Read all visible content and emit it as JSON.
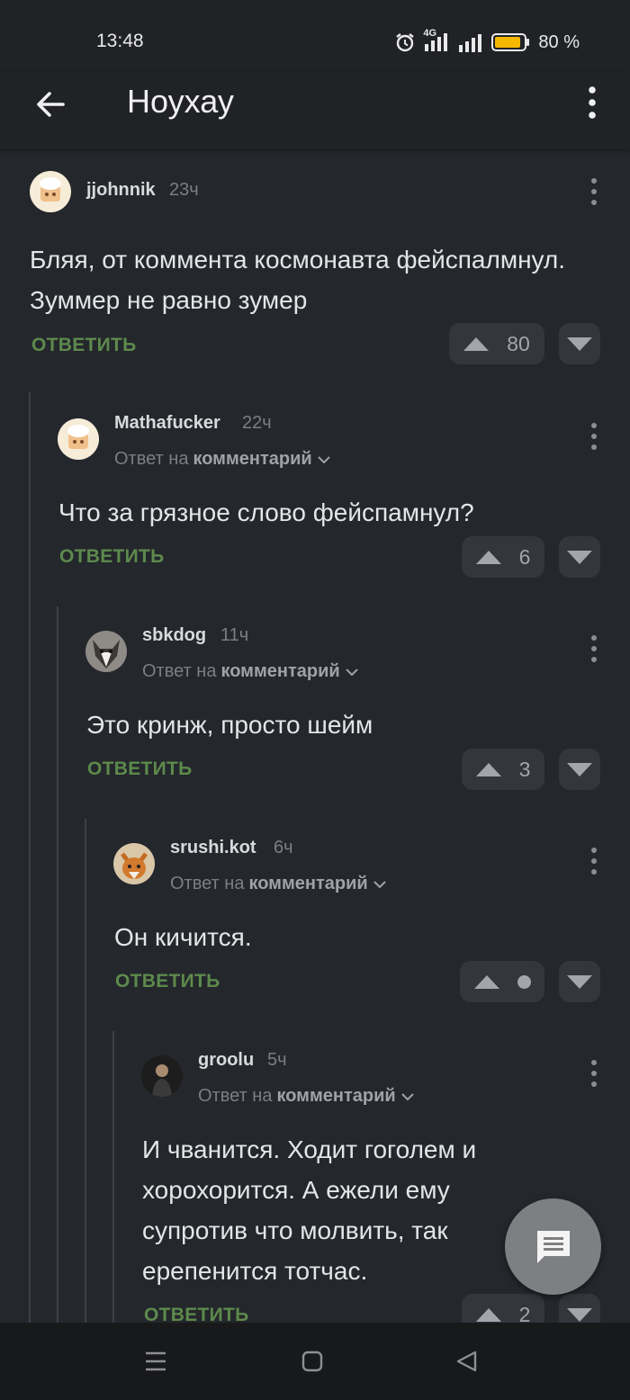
{
  "status": {
    "time": "13:48",
    "network": "4G",
    "battery": "80 %",
    "colors": {
      "battery": "#f4b800"
    }
  },
  "appbar": {
    "title": "Ноухау",
    "back_icon": "arrow-left-icon",
    "menu_icon": "more-vertical-icon"
  },
  "reply_label": "ОТВЕТИТЬ",
  "comments": [
    {
      "author": "jjohnnik",
      "time": "23ч",
      "text": "Бляя, от коммента космонавта фейспалмнул. Зуммер не равно зумер",
      "votes": "80"
    },
    {
      "author": "Mathafucker",
      "time": "22ч",
      "reply_prefix": "Ответ на",
      "reply_target": "комментарий",
      "text": "Что за грязное слово фейспамнул?",
      "votes": "6"
    },
    {
      "author": "sbkdog",
      "time": "11ч",
      "reply_prefix": "Ответ на",
      "reply_target": "комментарий",
      "text": "Это кринж, просто шейм",
      "votes": "3"
    },
    {
      "author": "srushi.kot",
      "time": "6ч",
      "reply_prefix": "Ответ на",
      "reply_target": "комментарий",
      "text": "Он кичится.",
      "votes": ""
    },
    {
      "author": "groolu",
      "time": "5ч",
      "reply_prefix": "Ответ на",
      "reply_target": "комментарий",
      "text": "И чванится. Ходит гоголем и хорохорится. А ежели ему супротив что молвить, так ерепенится тотчас.",
      "votes": "2"
    }
  ],
  "fab": {
    "icon": "comment-icon"
  },
  "navbar": {
    "icons": [
      "menu-icon",
      "home-square-icon",
      "back-triangle-icon"
    ]
  },
  "colors": {
    "reply": "#5d8a4c",
    "background": "#24272c"
  }
}
